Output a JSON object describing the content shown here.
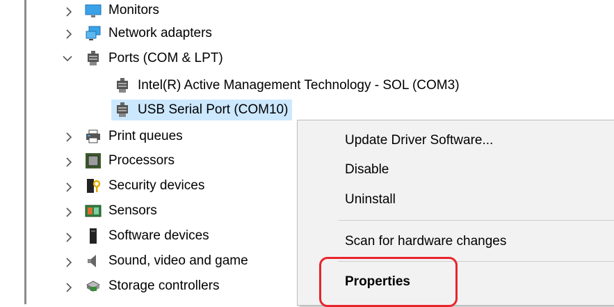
{
  "tree": {
    "items": [
      {
        "label": "Monitors",
        "icon": "monitor-icon",
        "expanded": false
      },
      {
        "label": "Network adapters",
        "icon": "network-adapter-icon",
        "expanded": false
      },
      {
        "label": "Ports (COM & LPT)",
        "icon": "port-icon",
        "expanded": true
      },
      {
        "label": "Intel(R) Active Management Technology - SOL (COM3)",
        "icon": "port-icon"
      },
      {
        "label": "USB Serial Port (COM10)",
        "icon": "port-icon",
        "selected": true
      },
      {
        "label": "Print queues",
        "icon": "printer-icon",
        "expanded": false
      },
      {
        "label": "Processors",
        "icon": "processor-icon",
        "expanded": false
      },
      {
        "label": "Security devices",
        "icon": "security-device-icon",
        "expanded": false
      },
      {
        "label": "Sensors",
        "icon": "sensor-icon",
        "expanded": false
      },
      {
        "label": "Software devices",
        "icon": "software-device-icon",
        "expanded": false
      },
      {
        "label": "Sound, video and game",
        "icon": "speaker-icon",
        "expanded": false
      },
      {
        "label": "Storage controllers",
        "icon": "storage-controller-icon",
        "expanded": false
      }
    ]
  },
  "context_menu": {
    "items": [
      {
        "label": "Update Driver Software..."
      },
      {
        "label": "Disable"
      },
      {
        "label": "Uninstall"
      },
      {
        "label": "Scan for hardware changes"
      },
      {
        "label": "Properties",
        "bold": true,
        "highlighted": true
      }
    ]
  },
  "colors": {
    "selection": "#cce8ff",
    "menu_background": "#f2f2f2",
    "highlight_border": "#e8242c"
  }
}
